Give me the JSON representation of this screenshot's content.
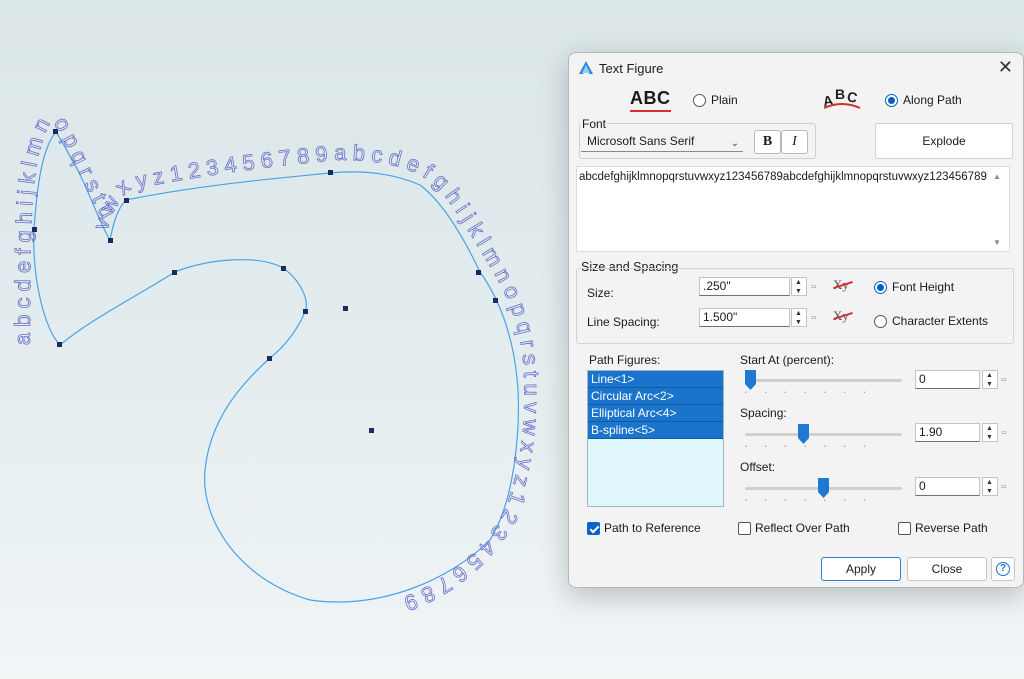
{
  "canvas": {
    "path_letters": [
      "abcdefghijklmnopqrstuvwxyz123456789abcdefghijklmnopqrstuvwxyz123456789"
    ]
  },
  "dialog": {
    "title": "Text Figure",
    "close_glyph": "✕",
    "mode": {
      "plain_sample": "ABC",
      "plain_label": "Plain",
      "along_path_sample": "ABC",
      "along_path_label": "Along Path",
      "selected": "along_path"
    },
    "font": {
      "label": "Font",
      "family": "Microsoft Sans Serif",
      "bold_label": "B",
      "italic_label": "I"
    },
    "explode_label": "Explode",
    "text_value": "abcdefghijklmnopqrstuvwxyz123456789abcdefghijklmnopqrstuvwxyz123456789",
    "size_spacing": {
      "label": "Size and Spacing",
      "size_label": "Size:",
      "size_value": ".250\"",
      "line_spacing_label": "Line Spacing:",
      "line_spacing_value": "1.500\"",
      "font_height_label": "Font Height",
      "character_extents_label": "Character Extents",
      "selected": "font_height",
      "xy_glyph": "Xy"
    },
    "path_figures": {
      "label": "Path Figures:",
      "items": [
        "Line<1>",
        "Circular Arc<2>",
        "Elliptical Arc<4>",
        "B-spline<5>"
      ]
    },
    "start_at": {
      "label": "Start At (percent):",
      "value": "0",
      "level": 0.0
    },
    "spacing": {
      "label": "Spacing:",
      "value": "1.90",
      "level": 0.38
    },
    "offset": {
      "label": "Offset:",
      "value": "0",
      "level": 0.5
    },
    "options": {
      "path_to_reference": {
        "label": "Path to Reference",
        "checked": true
      },
      "reflect_over_path": {
        "label": "Reflect Over Path",
        "checked": false
      },
      "reverse_path": {
        "label": "Reverse Path",
        "checked": false
      }
    },
    "buttons": {
      "apply": "Apply",
      "close": "Close",
      "help": "?"
    },
    "accent_color": "#1a74cc"
  }
}
